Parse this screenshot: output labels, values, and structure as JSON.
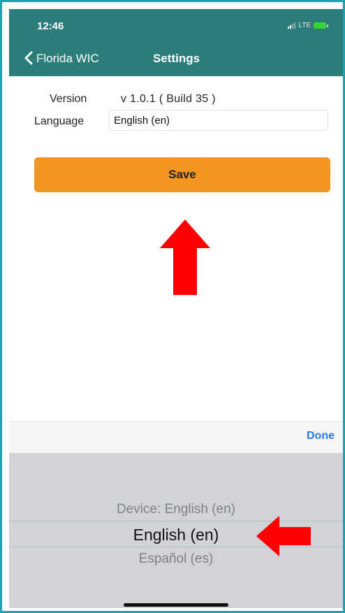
{
  "status_bar": {
    "time": "12:46",
    "network": "LTE",
    "battery_icon": "battery-charging-icon"
  },
  "nav": {
    "back_label": "Florida WIC",
    "back_icon": "chevron-left-icon",
    "title": "Settings"
  },
  "settings": {
    "version_label": "Version",
    "version_value": "v 1.0.1 ( Build 35 )",
    "language_label": "Language",
    "language_value": "English (en)"
  },
  "actions": {
    "save_label": "Save",
    "done_label": "Done"
  },
  "picker": {
    "options": [
      "Device: English (en)",
      "English (en)",
      "Español (es)"
    ],
    "selected_index": 1
  },
  "annotations": {
    "arrow_color": "#ff0000",
    "up_arrow_icon": "red-arrow-up-icon",
    "left_arrow_icon": "red-arrow-left-icon"
  },
  "colors": {
    "nav_bg": "#2b7d79",
    "accent_button": "#f49522",
    "done_blue": "#2a7ae4",
    "picker_bg": "#d1d3d9",
    "frame_border": "#1ba2ad"
  }
}
